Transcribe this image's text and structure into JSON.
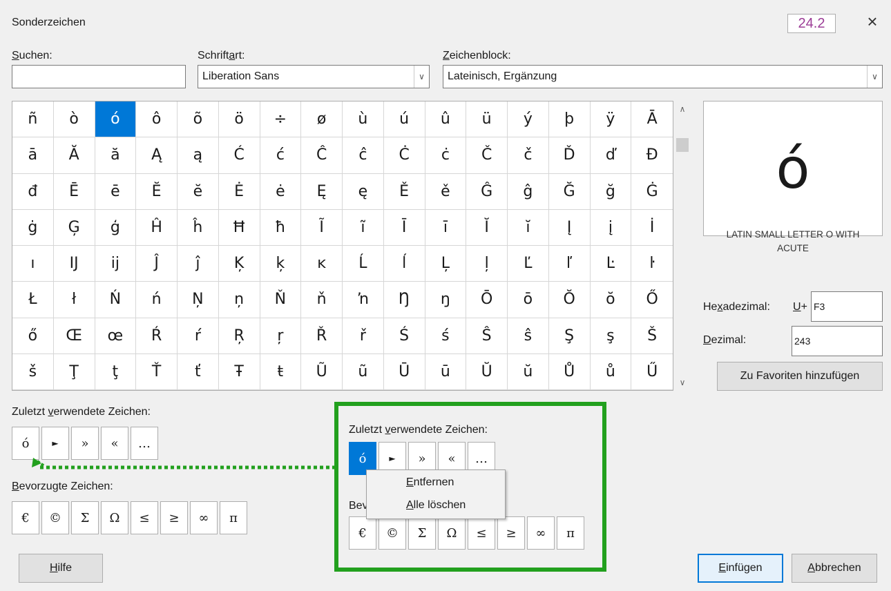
{
  "window": {
    "title": "Sonderzeichen",
    "version_badge": "24.2",
    "close_glyph": "×"
  },
  "search": {
    "label_u": "S",
    "label_rest": "uchen:",
    "value": ""
  },
  "font": {
    "label_pre": "Schrift",
    "label_u": "a",
    "label_rest": "rt:",
    "value": "Liberation Sans"
  },
  "block": {
    "label_u": "Z",
    "label_rest": "eichenblock:",
    "value": "Lateinisch, Ergänzung"
  },
  "grid": {
    "selected_index": 2,
    "chars": [
      "ñ",
      "ò",
      "ó",
      "ô",
      "õ",
      "ö",
      "÷",
      "ø",
      "ù",
      "ú",
      "û",
      "ü",
      "ý",
      "þ",
      "ÿ",
      "Ā",
      "ā",
      "Ă",
      "ă",
      "Ą",
      "ą",
      "Ć",
      "ć",
      "Ĉ",
      "ĉ",
      "Ċ",
      "ċ",
      "Č",
      "č",
      "Ď",
      "ď",
      "Đ",
      "đ",
      "Ē",
      "ē",
      "Ĕ",
      "ĕ",
      "Ė",
      "ė",
      "Ę",
      "ę",
      "Ě",
      "ě",
      "Ĝ",
      "ĝ",
      "Ğ",
      "ğ",
      "Ġ",
      "ġ",
      "Ģ",
      "ģ",
      "Ĥ",
      "ĥ",
      "Ħ",
      "ħ",
      "Ĩ",
      "ĩ",
      "Ī",
      "ī",
      "Ĭ",
      "ĭ",
      "Į",
      "į",
      "İ",
      "ı",
      "Ĳ",
      "ĳ",
      "Ĵ",
      "ĵ",
      "Ķ",
      "ķ",
      "ĸ",
      "Ĺ",
      "ĺ",
      "Ļ",
      "ļ",
      "Ľ",
      "ľ",
      "Ŀ",
      "ŀ",
      "Ł",
      "ł",
      "Ń",
      "ń",
      "Ņ",
      "ņ",
      "Ň",
      "ň",
      "ŉ",
      "Ŋ",
      "ŋ",
      "Ō",
      "ō",
      "Ŏ",
      "ŏ",
      "Ő",
      "ő",
      "Œ",
      "œ",
      "Ŕ",
      "ŕ",
      "Ŗ",
      "ŗ",
      "Ř",
      "ř",
      "Ś",
      "ś",
      "Ŝ",
      "ŝ",
      "Ş",
      "ş",
      "Š",
      "š",
      "Ţ",
      "ţ",
      "Ť",
      "ť",
      "Ŧ",
      "ŧ",
      "Ũ",
      "ũ",
      "Ū",
      "ū",
      "Ŭ",
      "ŭ",
      "Ů",
      "ů",
      "Ű"
    ]
  },
  "preview": {
    "char": "ó",
    "name_line1": "LATIN SMALL LETTER O WITH",
    "name_line2": "ACUTE",
    "hex_label_pre": "He",
    "hex_label_u": "x",
    "hex_label_rest": "adezimal:",
    "hex_prefix_u": "U",
    "hex_prefix_rest": "+",
    "hex_value": "F3",
    "dec_label_u": "D",
    "dec_label_rest": "ezimal:",
    "dec_value": "243",
    "favorites_button": "Zu Favoriten hinzufügen"
  },
  "recent": {
    "label_pre": "Zuletzt ",
    "label_u": "v",
    "label_rest": "erwendete Zeichen:",
    "chars": [
      "ó",
      "►",
      "»",
      "«",
      "…"
    ]
  },
  "favorites": {
    "label_u": "B",
    "label_rest": "evorzugte Zeichen:",
    "chars": [
      "€",
      "©",
      "Σ",
      "Ω",
      "≤",
      "≥",
      "∞",
      "π"
    ]
  },
  "callout": {
    "label_pre": "Zuletzt ",
    "label_u": "v",
    "label_rest": "erwendete Zeichen:",
    "recent_chars": [
      "ó",
      "►",
      "»",
      "«",
      "…"
    ],
    "fav_label_partial": "Bev",
    "fav_chars": [
      "€",
      "©",
      "Σ",
      "Ω",
      "≤",
      "≥",
      "∞",
      "π"
    ],
    "menu": {
      "remove_u": "E",
      "remove_rest": "ntfernen",
      "clear_u": "A",
      "clear_rest": "lle löschen"
    },
    "highlight_color": "#22a01e"
  },
  "buttons": {
    "help_u": "H",
    "help_rest": "ilfe",
    "insert_u": "E",
    "insert_rest": "infügen",
    "cancel_u": "A",
    "cancel_rest": "bbrechen"
  },
  "colors": {
    "accent": "#0078d7",
    "badge_text": "#9b3c96"
  }
}
